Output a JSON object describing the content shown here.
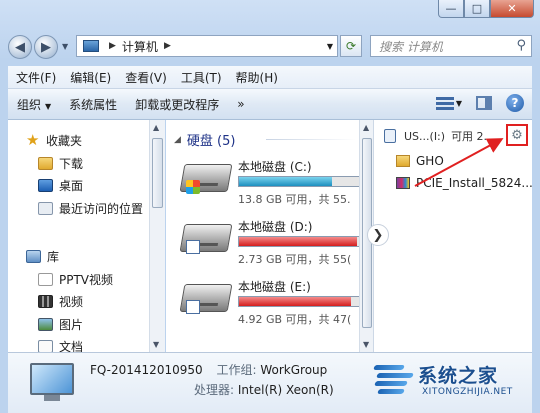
{
  "window": {
    "minimize": "—",
    "maximize": "□",
    "close": "✕"
  },
  "address": {
    "path": "计算机",
    "search_placeholder": "搜索 计算机"
  },
  "menu": [
    "文件(F)",
    "编辑(E)",
    "查看(V)",
    "工具(T)",
    "帮助(H)"
  ],
  "commands": {
    "organize": "组织",
    "properties": "系统属性",
    "uninstall": "卸载或更改程序",
    "more": "»"
  },
  "nav": {
    "favorites": "收藏夹",
    "downloads": "下载",
    "desktop": "桌面",
    "recent": "最近访问的位置",
    "libraries": "库",
    "pptv": "PPTV视频",
    "videos": "视频",
    "pictures": "图片",
    "documents": "文档"
  },
  "content": {
    "group": "硬盘 (5)",
    "drives": [
      {
        "name": "本地磁盘 (C:)",
        "free": "13.8 GB 可用，共 55.",
        "used_fraction": 0.75,
        "color": "#1d8fbf"
      },
      {
        "name": "本地磁盘 (D:)",
        "free": "2.73 GB 可用，共 55(",
        "used_fraction": 0.95,
        "color": "#d41e1e"
      },
      {
        "name": "本地磁盘 (E:)",
        "free": "4.92 GB 可用，共 47(",
        "used_fraction": 0.9,
        "color": "#d41e1e"
      }
    ]
  },
  "preview": {
    "usb_label": "US...(I:)",
    "usb_free": "可用 2.",
    "files": [
      "GHO",
      "PCIE_Install_5824..."
    ]
  },
  "details": {
    "computer_name": "FQ-201412010950",
    "workgroup_label": "工作组:",
    "workgroup": "WorkGroup",
    "cpu_label": "处理器:",
    "cpu": "Intel(R) Xeon(R)"
  },
  "watermark": {
    "cn": "系统之家",
    "en": "XITONGZHIJIA.NET"
  }
}
